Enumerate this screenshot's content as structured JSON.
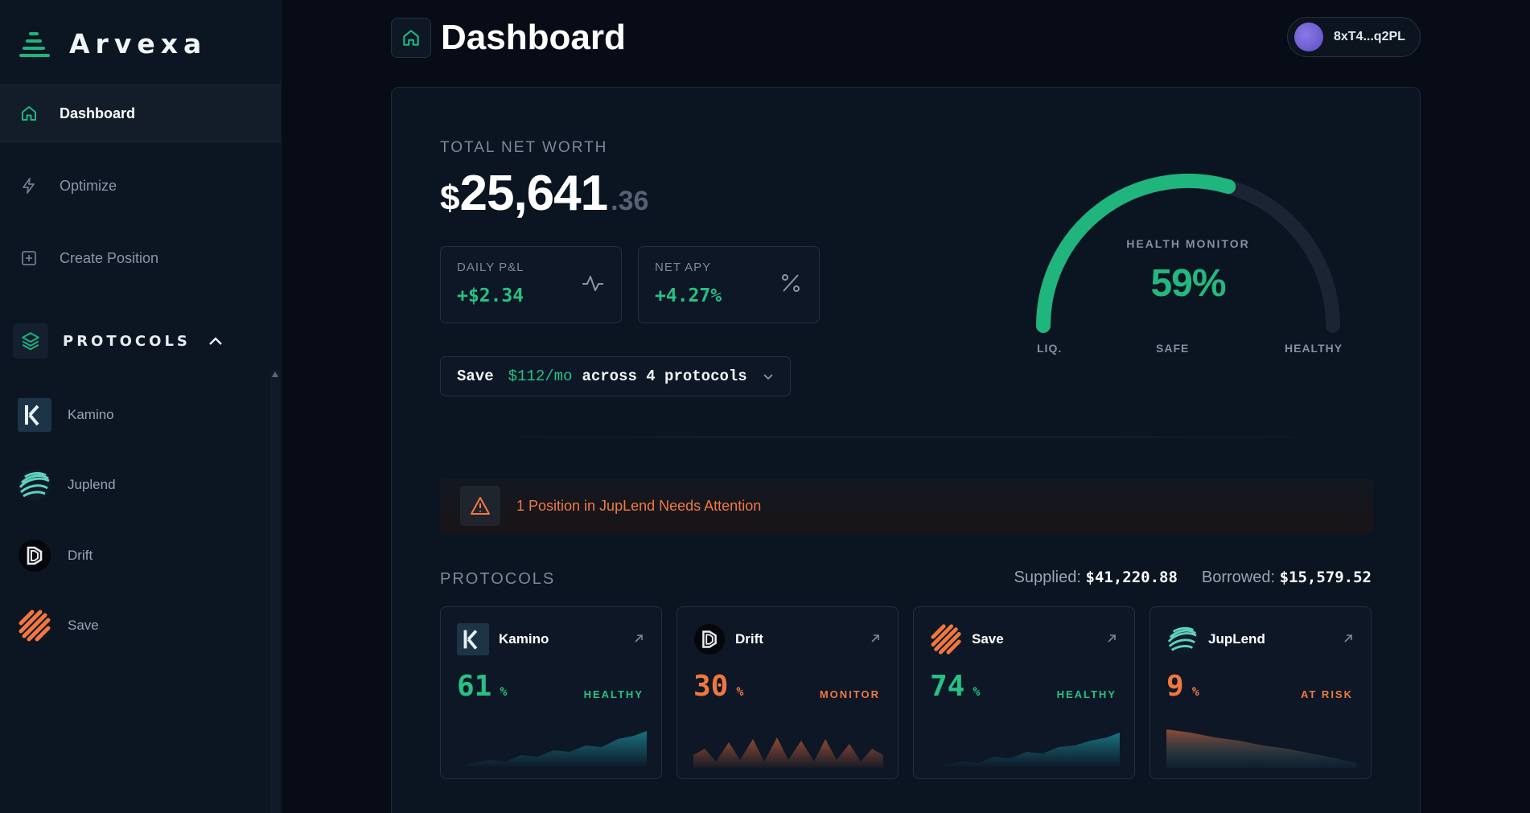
{
  "brand": {
    "name": "Arvexa"
  },
  "nav": [
    {
      "label": "Dashboard",
      "icon": "home-icon",
      "active": true
    },
    {
      "label": "Optimize",
      "icon": "lightning-icon",
      "active": false
    },
    {
      "label": "Create Position",
      "icon": "plus-square-icon",
      "active": false
    }
  ],
  "sidebar_protocols": {
    "heading": "PROTOCOLS",
    "items": [
      {
        "label": "Kamino",
        "icon": "kamino-logo"
      },
      {
        "label": "Juplend",
        "icon": "juplend-logo"
      },
      {
        "label": "Drift",
        "icon": "drift-logo"
      },
      {
        "label": "Save",
        "icon": "save-logo"
      }
    ]
  },
  "header": {
    "title": "Dashboard",
    "wallet": "8xT4...q2PL"
  },
  "net_worth": {
    "label": "TOTAL NET WORTH",
    "currency": "$",
    "integer": "25,641",
    "decimal": ".36"
  },
  "stats": {
    "daily_pnl": {
      "label": "DAILY P&L",
      "value": "+$2.34"
    },
    "net_apy": {
      "label": "NET APY",
      "value": "+4.27%"
    }
  },
  "savings": {
    "prefix": "Save",
    "amount": "$112/mo",
    "suffix": "across 4 protocols"
  },
  "health": {
    "label": "HEALTH MONITOR",
    "value": "59%",
    "fraction": 0.59,
    "ticks": {
      "left": "LIQ.",
      "middle": "SAFE",
      "right": "HEALTHY"
    },
    "color": "#1fb57d"
  },
  "alert": {
    "text": "1 Position in JupLend Needs Attention",
    "color": "#f07a43"
  },
  "protocols": {
    "label": "PROTOCOLS",
    "supplied_label": "Supplied:",
    "supplied": "$41,220.88",
    "borrowed_label": "Borrowed:",
    "borrowed": "$15,579.52",
    "cards": [
      {
        "name": "Kamino",
        "value": "61",
        "unit": "%",
        "status": "HEALTHY",
        "tone": "good"
      },
      {
        "name": "Drift",
        "value": "30",
        "unit": "%",
        "status": "MONITOR",
        "tone": "warn"
      },
      {
        "name": "Save",
        "value": "74",
        "unit": "%",
        "status": "HEALTHY",
        "tone": "good"
      },
      {
        "name": "JupLend",
        "value": "9",
        "unit": "%",
        "status": "AT RISK",
        "tone": "warn"
      }
    ]
  },
  "colors": {
    "accent": "#1fb57d",
    "good": "#27c184",
    "warn": "#f0773f"
  }
}
